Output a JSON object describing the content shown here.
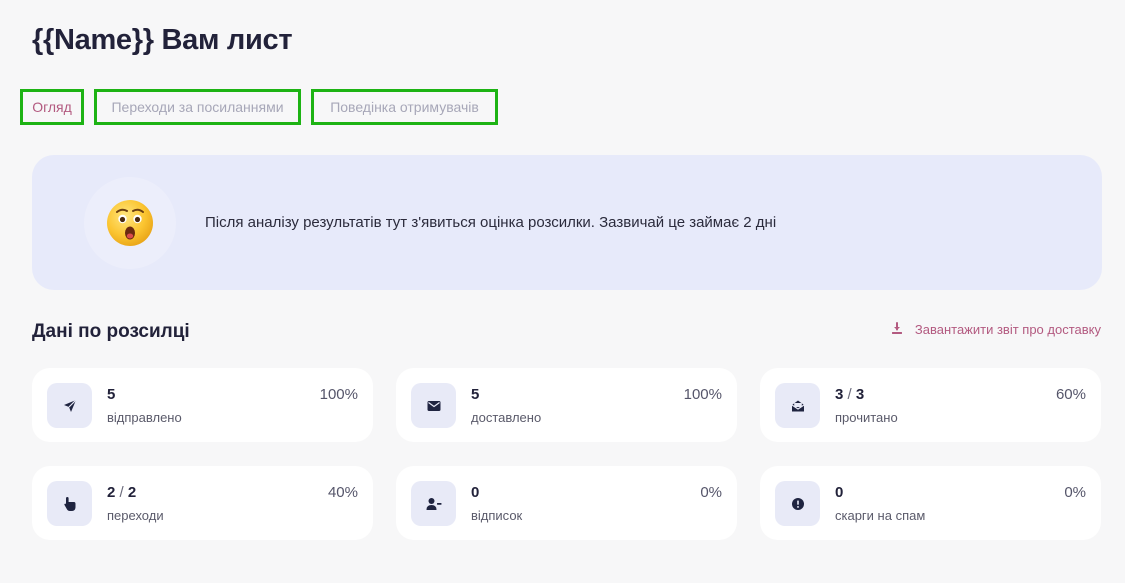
{
  "page": {
    "title": "{{Name}} Вам лист"
  },
  "tabs": [
    {
      "label": "Огляд",
      "active": true
    },
    {
      "label": "Переходи за посиланнями",
      "active": false
    },
    {
      "label": "Поведінка отримувачів",
      "active": false
    }
  ],
  "banner": {
    "icon": "astonished-face-emoji",
    "text": "Після аналізу результатів тут з'явиться оцінка розсилки. Зазвичай це займає 2 дні"
  },
  "section": {
    "title": "Дані по розсилці",
    "download_label": "Завантажити звіт про доставку"
  },
  "stats": [
    {
      "icon": "paper-plane-icon",
      "value": "5",
      "total": "",
      "label": "відправлено",
      "percent": "100%"
    },
    {
      "icon": "envelope-icon",
      "value": "5",
      "total": "",
      "label": "доставлено",
      "percent": "100%"
    },
    {
      "icon": "open-envelope-icon",
      "value": "3",
      "total": "3",
      "label": "прочитано",
      "percent": "60%"
    },
    {
      "icon": "pointer-hand-icon",
      "value": "2",
      "total": "2",
      "label": "переходи",
      "percent": "40%"
    },
    {
      "icon": "user-minus-icon",
      "value": "0",
      "total": "",
      "label": "відписок",
      "percent": "0%"
    },
    {
      "icon": "alert-icon",
      "value": "0",
      "total": "",
      "label": "скарги на спам",
      "percent": "0%"
    }
  ],
  "colors": {
    "accent": "#b35a80",
    "highlight_border": "#1db314",
    "banner_bg": "#e7eafa",
    "icon_bg": "#e8eaf7",
    "icon_fg": "#1f2440"
  }
}
